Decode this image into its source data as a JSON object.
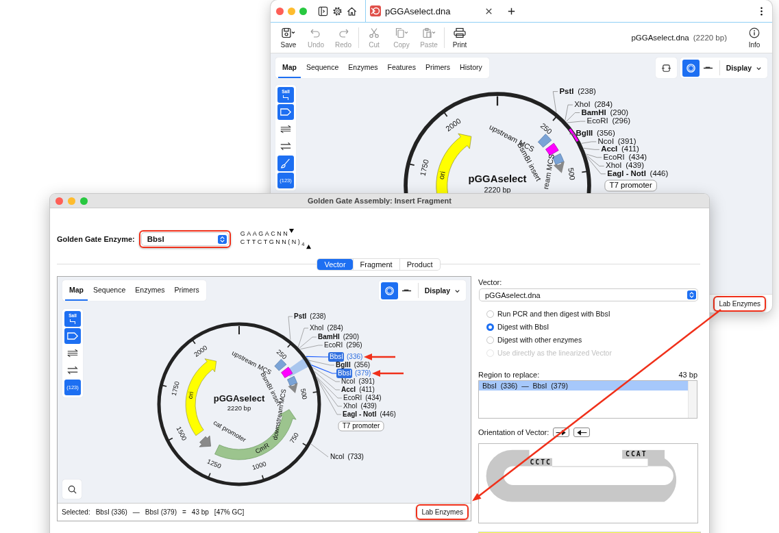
{
  "back_window": {
    "tab_title": "pGGAselect.dna",
    "toolbar": [
      {
        "kind": "save",
        "label": "Save",
        "disabled": false
      },
      {
        "kind": "undo",
        "label": "Undo",
        "disabled": true
      },
      {
        "kind": "redo",
        "label": "Redo",
        "disabled": true
      },
      {
        "kind": "cut",
        "label": "Cut",
        "disabled": true
      },
      {
        "kind": "copy",
        "label": "Copy",
        "disabled": true
      },
      {
        "kind": "paste",
        "label": "Paste",
        "disabled": true
      },
      {
        "kind": "print",
        "label": "Print",
        "disabled": false
      }
    ],
    "file_name": "pGGAselect.dna",
    "file_length": "(2220 bp)",
    "info_label": "Info",
    "view_tabs": [
      {
        "label": "Map",
        "selected": true
      },
      {
        "label": "Sequence",
        "selected": false
      },
      {
        "label": "Enzymes",
        "selected": false
      },
      {
        "label": "Features",
        "selected": false
      },
      {
        "label": "Primers",
        "selected": false
      },
      {
        "label": "History",
        "selected": false
      }
    ],
    "view_modes": [
      {
        "kind": "sequence",
        "selected": false
      },
      {
        "kind": "circular",
        "selected": true
      },
      {
        "kind": "linear",
        "selected": false
      }
    ],
    "display_label": "Display",
    "tools": [
      {
        "kind": "enzymes",
        "label": "SalI",
        "selected": true
      },
      {
        "kind": "features",
        "selected": true
      },
      {
        "kind": "orfs",
        "selected": false
      },
      {
        "kind": "strands",
        "selected": false
      },
      {
        "kind": "brush",
        "selected": true
      },
      {
        "kind": "numbers",
        "label": "(123)",
        "selected": true
      }
    ],
    "map": {
      "name": "pGGAselect",
      "length": "2220 bp",
      "ticks": [
        "250",
        "500",
        "1750",
        "2000"
      ],
      "arrows": [
        {
          "kind": "ori",
          "label": "ori"
        }
      ],
      "feature_labels": [
        "upstream MCS",
        "BsmBI insert",
        "ream MCS"
      ],
      "sites": [
        {
          "label": "PstI",
          "position": "(238)",
          "bold": true
        },
        {
          "label": "XhoI",
          "position": "(284)",
          "bold": false
        },
        {
          "label": "BamHI",
          "position": "(290)",
          "bold": true
        },
        {
          "label": "EcoRI",
          "position": "(296)",
          "bold": false
        },
        {
          "label": "BglII",
          "position": "(356)",
          "bold": true
        },
        {
          "label": "NcoI",
          "position": "(391)",
          "bold": false
        },
        {
          "label": "AccI",
          "position": "(411)",
          "bold": true
        },
        {
          "label": "EcoRI",
          "position": "(434)",
          "bold": false
        },
        {
          "label": "XhoI",
          "position": "(439)",
          "bold": false
        },
        {
          "label": "EagI - NotI",
          "position": "(446)",
          "bold": true
        }
      ],
      "promoter_label": "T7 promoter"
    },
    "footer_button": {
      "label": "Lab Enzymes",
      "callout": true
    }
  },
  "dialog": {
    "title": "Golden Gate Assembly: Insert Fragment",
    "enzyme_label": "Golden Gate Enzyme:",
    "enzyme": {
      "value": "BbsI",
      "callout": true
    },
    "site_top": "GAAGACNN",
    "site_bottom": "CTTCTGNN(N)$_{4}$",
    "steps": [
      {
        "label": "Vector",
        "selected": true
      },
      {
        "label": "Fragment",
        "selected": false
      },
      {
        "label": "Product",
        "selected": false
      }
    ],
    "map_panel": {
      "view_tabs": [
        {
          "label": "Map",
          "selected": true
        },
        {
          "label": "Sequence",
          "selected": false
        },
        {
          "label": "Enzymes",
          "selected": false
        },
        {
          "label": "Primers",
          "selected": false
        }
      ],
      "view_modes": [
        {
          "kind": "circular",
          "selected": true
        },
        {
          "kind": "linear",
          "selected": false
        }
      ],
      "display_label": "Display",
      "tools": [
        {
          "kind": "enzymes",
          "label": "SalI",
          "selected": true
        },
        {
          "kind": "features",
          "selected": true
        },
        {
          "kind": "orfs",
          "selected": false
        },
        {
          "kind": "strands",
          "selected": false
        },
        {
          "kind": "numbers",
          "label": "(123)",
          "selected": true
        }
      ],
      "map": {
        "name": "pGGAselect",
        "length": "2220 bp",
        "ticks": [
          "250",
          "500",
          "750",
          "1000",
          "1250",
          "1500",
          "1750",
          "2000"
        ],
        "arrows": [
          {
            "kind": "ori",
            "label": "ori"
          },
          {
            "kind": "cmr",
            "label": "CmR"
          },
          {
            "kind": "promoter"
          }
        ],
        "feature_labels": [
          "upstream MCS",
          "BsmBI insert",
          "downstream MCS",
          "cat promoter"
        ],
        "sites": [
          {
            "label": "PstI",
            "position": "(238)",
            "bold": true,
            "selected": false
          },
          {
            "label": "XhoI",
            "position": "(284)",
            "bold": false,
            "selected": false
          },
          {
            "label": "BamHI",
            "position": "(290)",
            "bold": true,
            "selected": false
          },
          {
            "label": "EcoRI",
            "position": "(296)",
            "bold": false,
            "selected": false
          },
          {
            "label": "BbsI",
            "position": "(336)",
            "bold": false,
            "selected": true
          },
          {
            "label": "BglII",
            "position": "(356)",
            "bold": true,
            "selected": false
          },
          {
            "label": "BbsI",
            "position": "(379)",
            "bold": false,
            "selected": true
          },
          {
            "label": "NcoI",
            "position": "(391)",
            "bold": false,
            "selected": false
          },
          {
            "label": "AccI",
            "position": "(411)",
            "bold": true,
            "selected": false
          },
          {
            "label": "EcoRI",
            "position": "(434)",
            "bold": false,
            "selected": false
          },
          {
            "label": "XhoI",
            "position": "(439)",
            "bold": false,
            "selected": false
          },
          {
            "label": "EagI - NotI",
            "position": "(446)",
            "bold": true,
            "selected": false
          }
        ],
        "other_sites": [
          {
            "label": "NcoI",
            "position": "(733)"
          }
        ],
        "promoter_label": "T7 promoter"
      },
      "status": [
        "Selected:",
        "BbsI (336)",
        "—",
        "BbsI (379)",
        "=",
        "43 bp",
        "[47% GC]"
      ],
      "footer_button": {
        "label": "Lab Enzymes",
        "callout": true
      }
    },
    "vector_label": "Vector:",
    "vector": "pGGAselect.dna",
    "methods": [
      {
        "label": "Run PCR and then digest with BbsI",
        "selected": false,
        "disabled": false
      },
      {
        "label": "Digest with BbsI",
        "selected": true,
        "disabled": false
      },
      {
        "label": "Digest with other enzymes",
        "selected": false,
        "disabled": false
      },
      {
        "label": "Use directly as the linearized Vector",
        "selected": false,
        "disabled": true
      }
    ],
    "region_label": "Region to replace:",
    "region_length": "43 bp",
    "regions": [
      {
        "label": "BbsI  (336)  —  BbsI  (379)",
        "selected": true
      }
    ],
    "orientation_label": "Orientation of Vector:",
    "orientations": [
      {
        "kind": "forward"
      },
      {
        "kind": "reverse"
      }
    ],
    "overhang_left": "CCTC",
    "overhang_right": "CCAT"
  }
}
